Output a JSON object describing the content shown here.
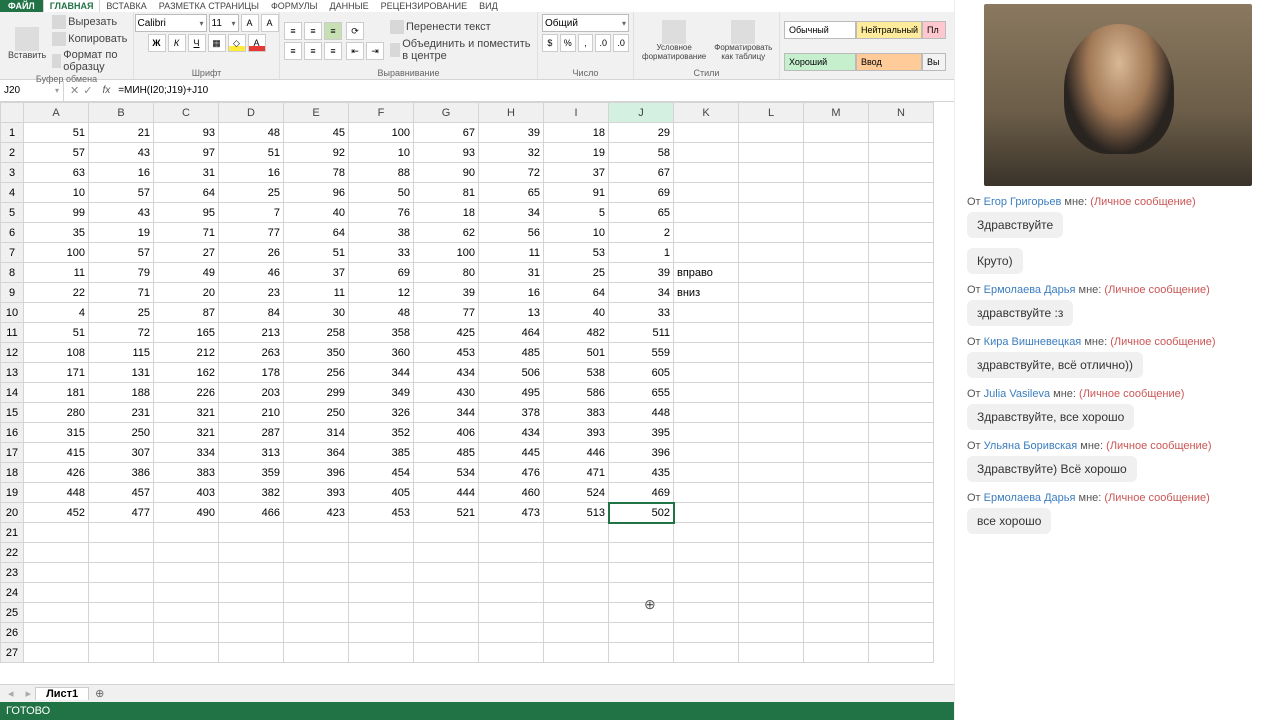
{
  "tabs": {
    "file": "ФАЙЛ",
    "home": "ГЛАВНАЯ",
    "insert": "ВСТАВКА",
    "layout": "РАЗМЕТКА СТРАНИЦЫ",
    "formulas": "ФОРМУЛЫ",
    "data": "ДАННЫЕ",
    "review": "РЕЦЕНЗИРОВАНИЕ",
    "view": "ВИД"
  },
  "ribbon": {
    "paste": "Вставить",
    "cut": "Вырезать",
    "copy": "Копировать",
    "fmtpaint": "Формат по образцу",
    "clipboard": "Буфер обмена",
    "font": "Calibri",
    "size": "11",
    "fontgrp": "Шрифт",
    "bold": "Ж",
    "italic": "К",
    "underline": "Ч",
    "aligngrp": "Выравнивание",
    "wrap": "Перенести текст",
    "merge": "Объединить и поместить в центре",
    "numfmt": "Общий",
    "numgrp": "Число",
    "condfmt": "Условное форматирование",
    "astable": "Форматировать как таблицу",
    "stylesgrp": "Стили",
    "normal": "Обычный",
    "neutral": "Нейтральный",
    "bad": "Пл",
    "good": "Хороший",
    "input": "Ввод",
    "output": "Вы"
  },
  "fbar": {
    "name": "J20",
    "formula": "=МИН(I20;J19)+J10"
  },
  "cols": [
    "A",
    "B",
    "C",
    "D",
    "E",
    "F",
    "G",
    "H",
    "I",
    "J",
    "K",
    "L",
    "M",
    "N"
  ],
  "rows": [
    [
      51,
      21,
      93,
      48,
      45,
      100,
      67,
      39,
      18,
      29,
      "",
      "",
      "",
      ""
    ],
    [
      57,
      43,
      97,
      51,
      92,
      10,
      93,
      32,
      19,
      58,
      "",
      "",
      "",
      ""
    ],
    [
      63,
      16,
      31,
      16,
      78,
      88,
      90,
      72,
      37,
      67,
      "",
      "",
      "",
      ""
    ],
    [
      10,
      57,
      64,
      25,
      96,
      50,
      81,
      65,
      91,
      69,
      "",
      "",
      "",
      ""
    ],
    [
      99,
      43,
      95,
      7,
      40,
      76,
      18,
      34,
      5,
      65,
      "",
      "",
      "",
      ""
    ],
    [
      35,
      19,
      71,
      77,
      64,
      38,
      62,
      56,
      10,
      2,
      "",
      "",
      "",
      ""
    ],
    [
      100,
      57,
      27,
      26,
      51,
      33,
      100,
      11,
      53,
      1,
      "",
      "",
      "",
      ""
    ],
    [
      11,
      79,
      49,
      46,
      37,
      69,
      80,
      31,
      25,
      39,
      "вправо",
      "",
      "",
      ""
    ],
    [
      22,
      71,
      20,
      23,
      11,
      12,
      39,
      16,
      64,
      34,
      "вниз",
      "",
      "",
      ""
    ],
    [
      4,
      25,
      87,
      84,
      30,
      48,
      77,
      13,
      40,
      33,
      "",
      "",
      "",
      ""
    ],
    [
      51,
      72,
      165,
      213,
      258,
      358,
      425,
      464,
      482,
      511,
      "",
      "",
      "",
      ""
    ],
    [
      108,
      115,
      212,
      263,
      350,
      360,
      453,
      485,
      501,
      559,
      "",
      "",
      "",
      ""
    ],
    [
      171,
      131,
      162,
      178,
      256,
      344,
      434,
      506,
      538,
      605,
      "",
      "",
      "",
      ""
    ],
    [
      181,
      188,
      226,
      203,
      299,
      349,
      430,
      495,
      586,
      655,
      "",
      "",
      "",
      ""
    ],
    [
      280,
      231,
      321,
      210,
      250,
      326,
      344,
      378,
      383,
      448,
      "",
      "",
      "",
      ""
    ],
    [
      315,
      250,
      321,
      287,
      314,
      352,
      406,
      434,
      393,
      395,
      "",
      "",
      "",
      ""
    ],
    [
      415,
      307,
      334,
      313,
      364,
      385,
      485,
      445,
      446,
      396,
      "",
      "",
      "",
      ""
    ],
    [
      426,
      386,
      383,
      359,
      396,
      454,
      534,
      476,
      471,
      435,
      "",
      "",
      "",
      ""
    ],
    [
      448,
      457,
      403,
      382,
      393,
      405,
      444,
      460,
      524,
      469,
      "",
      "",
      "",
      ""
    ],
    [
      452,
      477,
      490,
      466,
      423,
      453,
      521,
      473,
      513,
      502,
      "",
      "",
      "",
      ""
    ],
    [
      "",
      "",
      "",
      "",
      "",
      "",
      "",
      "",
      "",
      "",
      "",
      "",
      "",
      ""
    ],
    [
      "",
      "",
      "",
      "",
      "",
      "",
      "",
      "",
      "",
      "",
      "",
      "",
      "",
      ""
    ],
    [
      "",
      "",
      "",
      "",
      "",
      "",
      "",
      "",
      "",
      "",
      "",
      "",
      "",
      ""
    ],
    [
      "",
      "",
      "",
      "",
      "",
      "",
      "",
      "",
      "",
      "",
      "",
      "",
      "",
      ""
    ],
    [
      "",
      "",
      "",
      "",
      "",
      "",
      "",
      "",
      "",
      "",
      "",
      "",
      "",
      ""
    ],
    [
      "",
      "",
      "",
      "",
      "",
      "",
      "",
      "",
      "",
      "",
      "",
      "",
      "",
      ""
    ],
    [
      "",
      "",
      "",
      "",
      "",
      "",
      "",
      "",
      "",
      "",
      "",
      "",
      "",
      ""
    ]
  ],
  "selected": {
    "row": 20,
    "col": 10
  },
  "sheet": "Лист1",
  "status": "ГОТОВО",
  "chat": {
    "from": "От",
    "to": "мне:",
    "priv": "(Личное сообщение)",
    "messages": [
      {
        "name": "Егор Григорьев",
        "text": "Здравствуйте"
      },
      {
        "name": "",
        "text": "Круто)"
      },
      {
        "name": "Ермолаева Дарья",
        "text": "здравствуйте :з"
      },
      {
        "name": "Кира Вишневецкая",
        "text": "здравствуйте, всё отлично))"
      },
      {
        "name": "Julia Vasileva",
        "text": "Здравствуйте, все хорошо"
      },
      {
        "name": "Ульяна Боривская",
        "text": "Здравствуйте) Всё хорошо"
      },
      {
        "name": "Ермолаева Дарья",
        "text": "все хорошо"
      }
    ]
  }
}
